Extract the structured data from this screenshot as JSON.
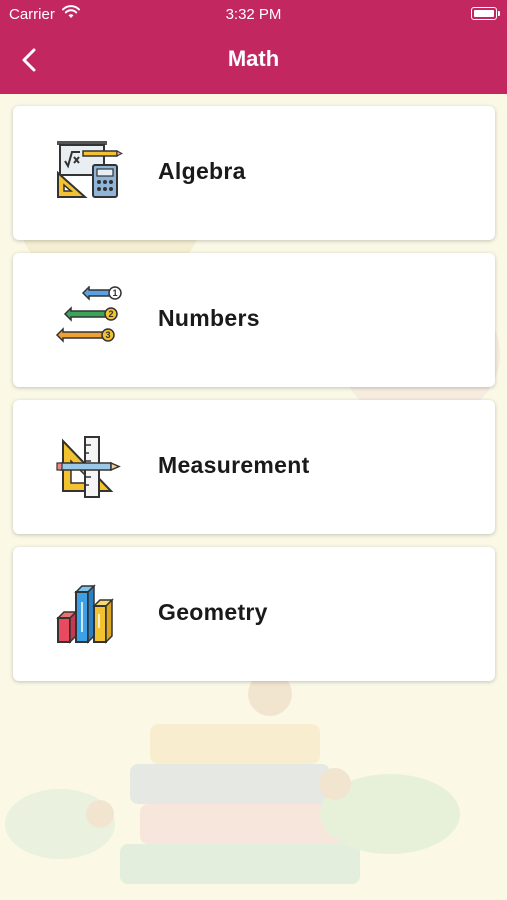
{
  "status_bar": {
    "carrier": "Carrier",
    "time": "3:32 PM"
  },
  "nav": {
    "title": "Math",
    "back_icon": "chevron-left-icon"
  },
  "theme": {
    "header_color": "#c2285f",
    "background_color": "#fbf8e6"
  },
  "categories": [
    {
      "label": "Algebra",
      "icon": "algebra-icon"
    },
    {
      "label": "Numbers",
      "icon": "numbers-icon"
    },
    {
      "label": "Measurement",
      "icon": "measurement-icon"
    },
    {
      "label": "Geometry",
      "icon": "geometry-icon"
    }
  ]
}
